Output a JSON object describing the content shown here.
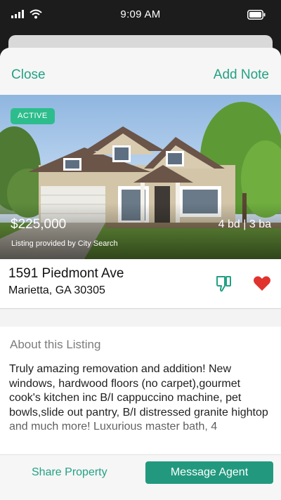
{
  "status_bar": {
    "time": "9:09 AM"
  },
  "nav": {
    "close_label": "Close",
    "add_note_label": "Add Note"
  },
  "listing": {
    "status": "ACTIVE",
    "price": "$225,000",
    "beds_baths": "4 bd | 3 ba",
    "provider": "Listing provided by City Search",
    "address_line1": "1591 Piedmont Ave",
    "address_line2": "Marietta, GA 30305",
    "favorited": true
  },
  "about": {
    "title": "About this Listing",
    "body": "Truly amazing removation and addition! New windows, hardwood floors (no carpet),gourmet cook's kitchen inc B/I cappuccino machine, pet bowls,slide out pantry, B/I distressed granite hightop and much more! Luxurious master bath, 4"
  },
  "actions": {
    "share_label": "Share Property",
    "message_label": "Message Agent"
  },
  "colors": {
    "accent": "#23a184",
    "badge": "#2dbd8c",
    "favorite": "#e0332d"
  }
}
